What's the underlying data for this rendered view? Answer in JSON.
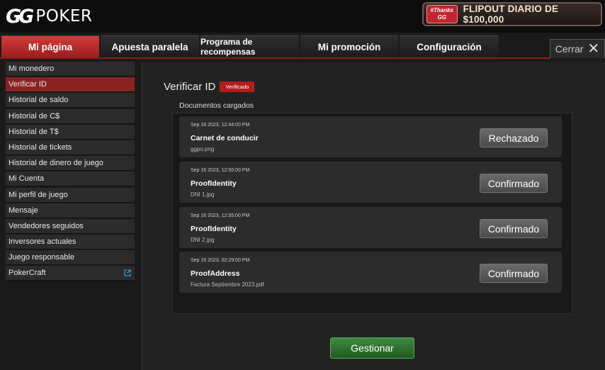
{
  "header": {
    "logo_gg": "GG",
    "logo_poker": "POKER",
    "promo_badge": "#Thanks GG",
    "promo_text": "FLIPOUT DIARIO DE $100,000"
  },
  "tabs": [
    {
      "label": "Mi página",
      "active": true
    },
    {
      "label": "Apuesta paralela",
      "active": false
    },
    {
      "label": "Programa de recompensas",
      "active": false
    },
    {
      "label": "Mi promoción",
      "active": false
    },
    {
      "label": "Configuración",
      "active": false
    }
  ],
  "close_label": "Cerrar",
  "sidebar": {
    "items": [
      {
        "label": "Mi monedero"
      },
      {
        "label": "Verificar ID",
        "active": true
      },
      {
        "label": "Historial de saldo"
      },
      {
        "label": "Historial de C$"
      },
      {
        "label": "Historial de T$"
      },
      {
        "label": "Historial de tickets"
      },
      {
        "label": "Historial de dinero de juego"
      },
      {
        "label": "Mi Cuenta"
      },
      {
        "label": "Mi perfil de juego"
      },
      {
        "label": "Mensaje"
      },
      {
        "label": "Vendedores seguidos"
      },
      {
        "label": "Inversores actuales"
      },
      {
        "label": "Juego responsable"
      },
      {
        "label": "PokerCraft",
        "icon": "external-link-icon"
      }
    ]
  },
  "main": {
    "title": "Verificar ID",
    "status_badge": "Verificado",
    "docs_label": "Documentos cargados",
    "documents": [
      {
        "date": "Sep 16 2023, 12:44:00 PM",
        "name": "Carnet de conducir",
        "file": "ggpo.png",
        "status": "Rechazado"
      },
      {
        "date": "Sep 16 2023, 12:55:00 PM",
        "name": "ProofIdentity",
        "file": "DNI 1.jpg",
        "status": "Confirmado"
      },
      {
        "date": "Sep 16 2023, 12:55:00 PM",
        "name": "ProofIdentity",
        "file": "DNI 2.jpg",
        "status": "Confirmado"
      },
      {
        "date": "Sep 16 2023, 02:29:00 PM",
        "name": "ProofAddress",
        "file": "Factura Septiembre 2023.pdf",
        "status": "Confirmado"
      }
    ],
    "manage_label": "Gestionar"
  },
  "colors": {
    "accent_red": "#b41c1c",
    "active_tab": "#d43a3a",
    "manage_green": "#3f8a3f"
  }
}
